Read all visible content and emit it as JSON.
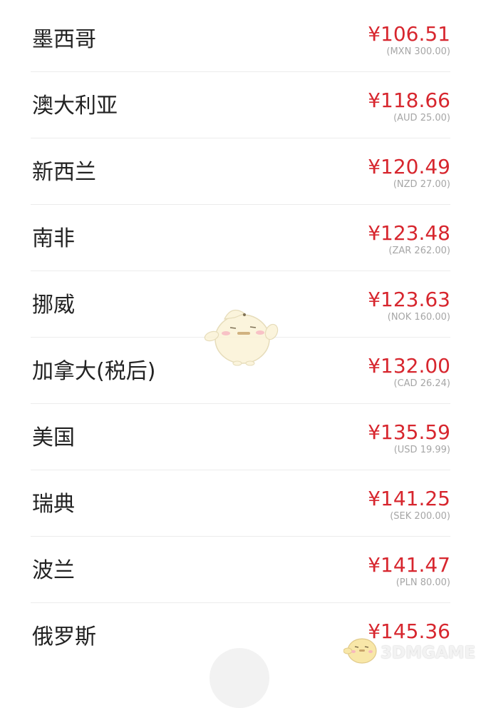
{
  "rows": [
    {
      "country": "墨西哥",
      "price": "¥106.51",
      "original": "(MXN 300.00)"
    },
    {
      "country": "澳大利亚",
      "price": "¥118.66",
      "original": "(AUD 25.00)"
    },
    {
      "country": "新西兰",
      "price": "¥120.49",
      "original": "(NZD 27.00)"
    },
    {
      "country": "南非",
      "price": "¥123.48",
      "original": "(ZAR 262.00)"
    },
    {
      "country": "挪威",
      "price": "¥123.63",
      "original": "(NOK 160.00)"
    },
    {
      "country": "加拿大(税后)",
      "price": "¥132.00",
      "original": "(CAD 26.24)"
    },
    {
      "country": "美国",
      "price": "¥135.59",
      "original": "(USD 19.99)"
    },
    {
      "country": "瑞典",
      "price": "¥141.25",
      "original": "(SEK 200.00)"
    },
    {
      "country": "波兰",
      "price": "¥141.47",
      "original": "(PLN 80.00)"
    },
    {
      "country": "俄罗斯",
      "price": "¥145.36",
      "original": ""
    }
  ],
  "watermark": {
    "text": "3DMGAME"
  },
  "colors": {
    "price": "#d7262e",
    "original": "#a6a6a6",
    "text": "#222222",
    "divider": "#ececec"
  }
}
